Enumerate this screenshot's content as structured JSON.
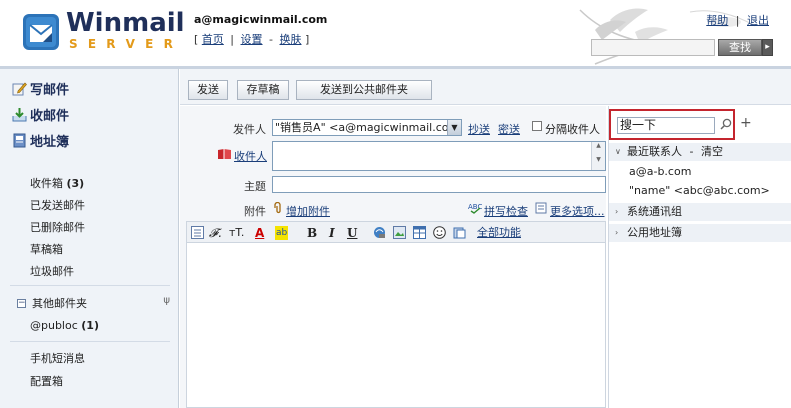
{
  "header": {
    "logo_title": "Winmail",
    "logo_subtitle": "SERVER",
    "user_email": "a@magicwinmail.com",
    "nav": {
      "open_bracket": "[",
      "home": "首页",
      "settings": "设置",
      "skin": "换肤",
      "close_bracket": "]",
      "sep1": "|",
      "sep2": "-"
    },
    "help": "帮助",
    "logout": "退出",
    "links_sep": "|",
    "search_button": "查找"
  },
  "sidebar": {
    "compose": "写邮件",
    "receive": "收邮件",
    "address_book": "地址簿",
    "folders": [
      {
        "label": "收件箱",
        "count": "(3)"
      },
      {
        "label": "已发送邮件",
        "count": ""
      },
      {
        "label": "已删除邮件",
        "count": ""
      },
      {
        "label": "草稿箱",
        "count": ""
      },
      {
        "label": "垃圾邮件",
        "count": ""
      }
    ],
    "other_folders": "其他邮件夹",
    "other_folders_toggle": "−",
    "publoc": {
      "label": "@publoc",
      "count": "(1)"
    },
    "sms": "手机短消息",
    "config": "配置箱"
  },
  "toolbar": {
    "send": "发送",
    "save_draft": "存草稿",
    "send_to_public": "发送到公共邮件夹"
  },
  "form": {
    "sender_label": "发件人",
    "sender_value": "\"销售员A\" <a@magicwinmail.com>",
    "cc": "抄送",
    "bcc": "密送",
    "separate_label": "分隔收件人",
    "to_label": "收件人",
    "subject_label": "主题",
    "attach_label": "附件",
    "add_attachment": "增加附件",
    "spell_check": "拼写检查",
    "more_options": "更多选项..."
  },
  "editor": {
    "bold": "B",
    "italic": "I",
    "underline": "U",
    "all_features": "全部功能",
    "font_sym": "𝓕.",
    "size_sym": "тT.",
    "color_sym": "A",
    "highlight_sym": "ab"
  },
  "contacts": {
    "search_value": "搜一下",
    "add": "+",
    "recent_label": "最近联系人",
    "recent_sep": "-",
    "clear": "清空",
    "recent_items": [
      "a@a-b.com",
      "\"name\" <abc@abc.com>"
    ],
    "system_group": "系统通讯组",
    "public_book": "公用地址簿"
  },
  "colors": {
    "brand_navy": "#1f2f5a",
    "brand_orange": "#e39a1a",
    "highlight_red": "#c4252e",
    "sidebar_bg": "#eff3f8"
  }
}
